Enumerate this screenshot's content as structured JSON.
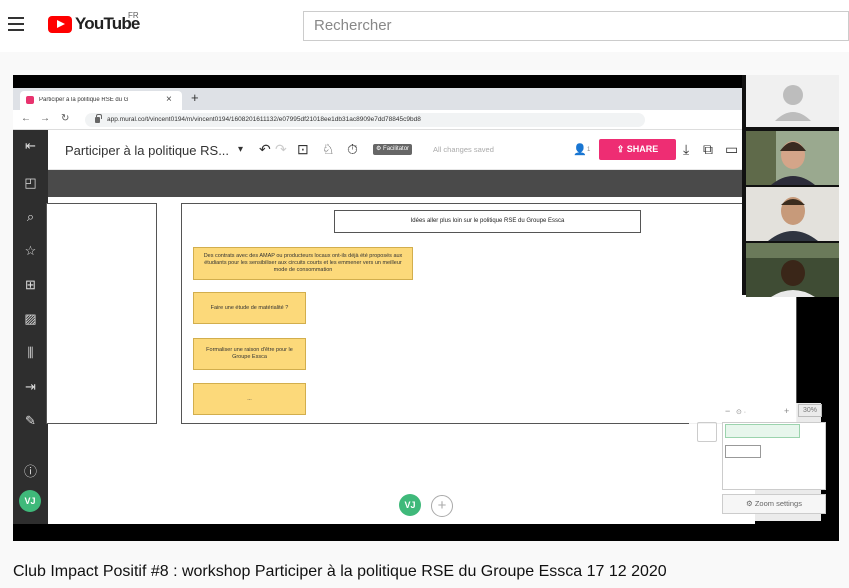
{
  "header": {
    "logo_text": "YouTube",
    "logo_country": "FR",
    "search_placeholder": "Rechercher"
  },
  "browser": {
    "tab_title": "Participer à la politique RSE du G",
    "tab_close": "×",
    "new_tab": "+",
    "url": "app.mural.co/t/vincent0194/m/vincent0194/1608201611132/e07995df21018ee1db31ac8909e7dd78845c9bd8"
  },
  "mural": {
    "board_title": "Participer à la politique RS...",
    "facilitator_label": "⚙ Facilitator",
    "saved_status": "All changes saved",
    "participant_count": "1",
    "share_label": "SHARE",
    "canvas_title": "Idées aller plus loin sur le politique RSE du Groupe Essca",
    "stickies": [
      "Des contrats avec des AMAP ou producteurs locaux ont-ils déjà été proposés aux étudiants pour les sensibiliser aux circuits courts et les emmener vers un meilleur mode de consommation",
      "Faire une étude de matérialité ?",
      "Formaliser une raison d'être pour le Groupe Essca",
      "..."
    ],
    "zoom_percent": "30%",
    "zoom_minus": "−",
    "zoom_plus": "+",
    "zoom_settings_label": "Zoom settings",
    "user_initials": "VJ",
    "add_label": "+"
  },
  "video": {
    "title": "Club Impact Positif #8 : workshop Participer à la politique RSE du Groupe Essca 17 12 2020"
  },
  "colors": {
    "youtube_red": "#ff0000",
    "share_pink": "#ee2d73",
    "sticky_yellow": "#fcd97a",
    "avatar_green": "#3fb97a"
  }
}
